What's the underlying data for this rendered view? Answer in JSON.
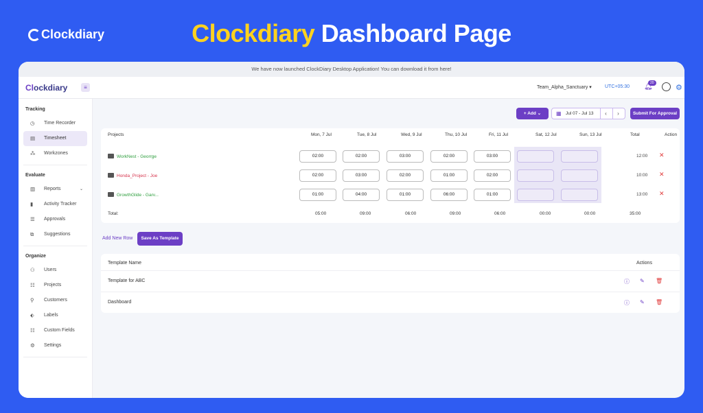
{
  "hero": {
    "brand": "Clockdiary",
    "title_brand": "Clockdiary",
    "title_rest": "Dashboard Page"
  },
  "announcement": "We have now launched ClockDiary Desktop Application! You can download it from here!",
  "topbar": {
    "logo_prefix": "Cl",
    "logo_rest": "ockdiary",
    "team": "Team_Alpha_Sanctuary",
    "timezone": "UTC+05:30",
    "notification_count": "20"
  },
  "sidebar": {
    "sections": [
      {
        "title": "Tracking",
        "items": [
          {
            "label": "Time Recorder",
            "icon": "clock-icon"
          },
          {
            "label": "Timesheet",
            "icon": "timesheet-icon",
            "active": true
          },
          {
            "label": "Workzones",
            "icon": "workzones-icon"
          }
        ]
      },
      {
        "title": "Evaluate",
        "items": [
          {
            "label": "Reports",
            "icon": "reports-icon"
          },
          {
            "label": "Activity Tracker",
            "icon": "activity-icon"
          },
          {
            "label": "Approvals",
            "icon": "approvals-icon"
          },
          {
            "label": "Suggestions",
            "icon": "suggestions-icon"
          }
        ]
      },
      {
        "title": "Organize",
        "items": [
          {
            "label": "Users",
            "icon": "users-icon"
          },
          {
            "label": "Projects",
            "icon": "projects-icon"
          },
          {
            "label": "Customers",
            "icon": "customers-icon"
          },
          {
            "label": "Labels",
            "icon": "labels-icon"
          },
          {
            "label": "Custom Fields",
            "icon": "custom-fields-icon"
          },
          {
            "label": "Settings",
            "icon": "settings-icon"
          }
        ]
      }
    ]
  },
  "toolbar": {
    "add_label": "Add",
    "date_range": "Jul 07 - Jul 13",
    "submit_label": "Submit For Approval"
  },
  "timesheet": {
    "headers": [
      "Projects",
      "Mon, 7 Jul",
      "Tue, 8 Jul",
      "Wed, 9 Jul",
      "Thu, 10 Jul",
      "Fri, 11 Jul",
      "Sat, 12 Jul",
      "Sun, 13 Jul",
      "Total",
      "Action"
    ],
    "rows": [
      {
        "project": "WorkNest - Georrge",
        "color": "#2e9e3e",
        "hours": [
          "02:00",
          "02:00",
          "03:00",
          "02:00",
          "03:00",
          "",
          ""
        ],
        "total": "12:00"
      },
      {
        "project": "Honda_Project - Joe",
        "color": "#d6334c",
        "hours": [
          "02:00",
          "03:00",
          "02:00",
          "01:00",
          "02:00",
          "",
          ""
        ],
        "total": "10:00"
      },
      {
        "project": "GrowthGlide - Garv...",
        "color": "#2e9e3e",
        "hours": [
          "01:00",
          "04:00",
          "01:00",
          "06:00",
          "01:00",
          "",
          ""
        ],
        "total": "13:00"
      }
    ],
    "footer_label": "Total:",
    "footer": [
      "05:00",
      "09:00",
      "06:00",
      "09:00",
      "06:00",
      "00:00",
      "00:00",
      "35:00"
    ]
  },
  "actions": {
    "add_row": "Add New Row",
    "save_template": "Save As Template"
  },
  "templates": {
    "col_name": "Template Name",
    "col_actions": "Actions",
    "rows": [
      "Template for ABC",
      "Dashboard"
    ]
  }
}
